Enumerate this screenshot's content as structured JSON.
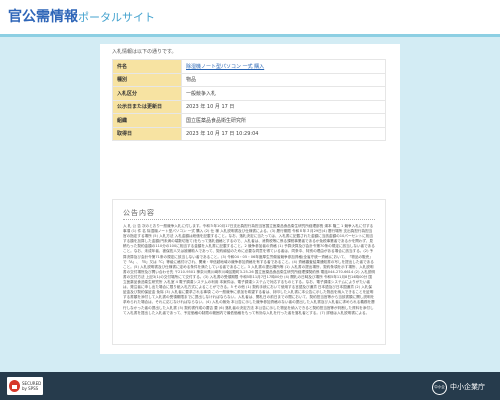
{
  "header": {
    "title_main": "官公需情報",
    "title_sub": "ポータルサイト"
  },
  "intro": "入札情報は以下の通りです。",
  "info_rows": [
    {
      "label": "件名",
      "value": "除湿機ノート型パソコン 一式 購入"
    },
    {
      "label": "種別",
      "value": "物品"
    },
    {
      "label": "入札区分",
      "value": "一般競争入札"
    },
    {
      "label": "公示日または更新日",
      "value": "2023 年 10 月 17 日"
    },
    {
      "label": "組織",
      "value": "国立医薬品食品衛生研究所"
    },
    {
      "label": "取得日",
      "value": "2023 年 10 月 17 日 10:29:04"
    }
  ],
  "notice": {
    "title": "公告内容",
    "body": "入 札 公 告 次のとおり一般競争入札に付します。令和５年10月17日支出負担行為担当官国立医薬品食品衛生研究所経理部長 湯本 隆二 1 競争入札に付する事項 (1) 件 名 除湿機ノート型パソコン 一式 購入 (2) 仕 様 入札説明書及び仕様書による。(3) 履行期限 令和６年３月29日(4) 履行場所 支出負担行為担当官の指定する場所 (5) 入札方法 入札金額は総価を記載すること。なお、落札決定に当たっては、入札書に記載された金額に当該金額の10パーセントに相当する額を加算した金額(円未満の端数切捨て)をもって落札価格とするので、入札者は、消費税等に係る課税事業者であるか免税事業者であるかを問わず、見積もった契約金額の110分の100に相当する金額を入札書に記載すること。2 競争参加者の資格 (1) 予算決算及び会計令第70条の規定に該当しない者であること。なお、未成年者、被保佐人又は被補助人であって、契約締結のために必要な同意を得ている者は、同条中、特別の理由がある場合に該当する。(2) 予算決算及び会計令第71条の規定に該当しない者であること。(3) 令和04・05・06年度厚生労働省競争参加資格(全省庁統一資格)において、「物品の販売」で「A」、「B」又は「C」等級に格付けされ、関東・甲信越地域の競争参加資格を有する者であること。(4) 資格審査結果通知書の写しを提出した者であること。(5) 入札説明書及び仕様書に定める条件を満たしている者であること。3 入札書の提出場所等 (1) 入札書の提出場所、契約条項を示す場所、入札説明書の交付場所及び問い合わせ先 〒210-9501 神奈川県川崎市川崎区殿町3-25-26 国立医薬品食品衛生研究所経理課契約係 電話044-270-6614 (2) 入札説明書の交付方法 上記3(1)の交付場所にて交付する。(3) 入札書の受領期限 令和5年11月7日17時00分 (4) 開札の日時及び場所 令和5年11月8日14時00分 国立医薬品食品衛生研究所 入札室 4 電子調達システムの利用 本案件は、電子調達システムで対応するものとする。なお、電子調達システムによりがたい者は、発注者に申し出た場合に限り紙入札方式によることができる。5 その他 (1) 契約手続において使用する言語及び通貨 日本語及び日本国通貨 (2) 入札保証金及び契約保証金 免除 (3) 入札者に要求される事項 この一般競争に参加を希望する者は、封印した入札書に本公告に示した物品を納入できることを証明する書類を添付して入札書の受領期限までに提出しなければならない。入札者は、開札日の前日までの間において、契約担当官等から当該書類に関し説明を求められた場合は、それに応じなければならない。(4) 入札の無効 本公告に示した競争参加資格のない者の提出した入札書及び入札者に求められる義務を履行しなかった者の提出した入札書 (5) 契約書作成の要否 要 (6) 落札者の決定方法 本公告に示した物品を納入できると契約担当官等が判断した資料を添付して入札書を提出した入札者であって、予定価格の制限の範囲内で最低価格をもって有効な入札を行った者を落札者とする。(7) 詳細は入札説明書による。"
  },
  "footer": {
    "badge_line1": "SECURED",
    "badge_line2": "by SPSS",
    "logo_label": "中小企業庁",
    "agency": "中小企業庁"
  },
  "colors": {
    "page_bg": "#d3ecf4",
    "brand_blue": "#2f66b8",
    "label_bg": "#f7e3a2",
    "footer_bg": "#263b4c",
    "link": "#2563b3"
  }
}
